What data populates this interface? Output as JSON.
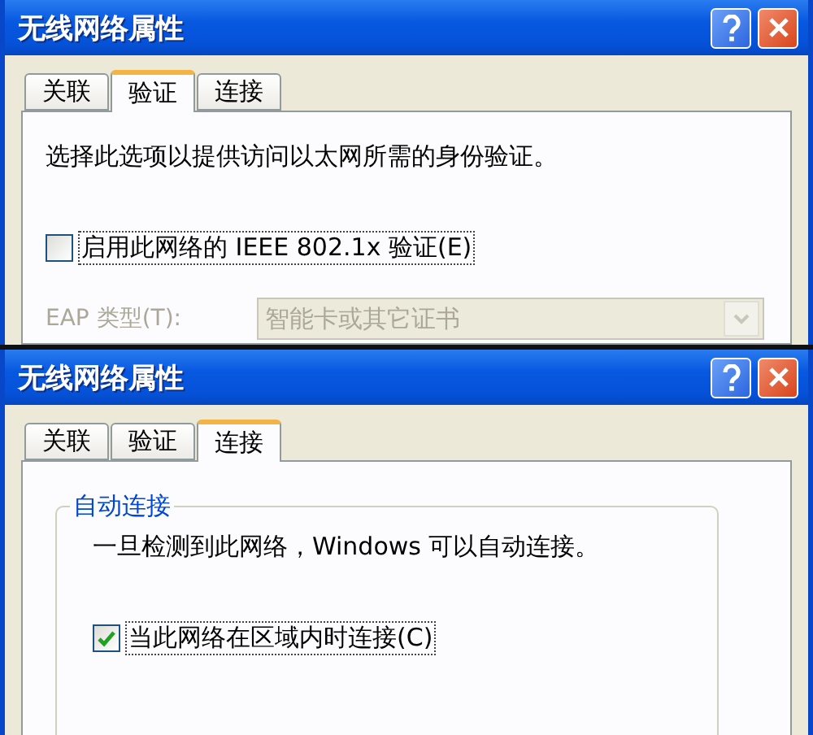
{
  "dialogs": [
    {
      "title": "无线网络属性",
      "tabs": [
        {
          "label": "关联",
          "selected": false
        },
        {
          "label": "验证",
          "selected": true
        },
        {
          "label": "连接",
          "selected": false
        }
      ],
      "content": [
        {
          "kind": "text",
          "text": "选择此选项以提供访问以太网所需的身份验证。"
        },
        {
          "kind": "checkbox",
          "label": "启用此网络的 IEEE 802.1x 验证(E)",
          "checked": false,
          "focused": true
        },
        {
          "kind": "select",
          "label": "EAP 类型(T):",
          "value": "智能卡或其它证书",
          "disabled": true
        }
      ]
    },
    {
      "title": "无线网络属性",
      "tabs": [
        {
          "label": "关联",
          "selected": false
        },
        {
          "label": "验证",
          "selected": false
        },
        {
          "label": "连接",
          "selected": true
        }
      ],
      "content": [
        {
          "kind": "group",
          "legend": "自动连接",
          "items": [
            {
              "kind": "text",
              "text": "一旦检测到此网络，Windows 可以自动连接。"
            },
            {
              "kind": "checkbox",
              "label": "当此网络在区域内时连接(C)",
              "checked": true,
              "focused": true
            }
          ]
        }
      ]
    }
  ]
}
